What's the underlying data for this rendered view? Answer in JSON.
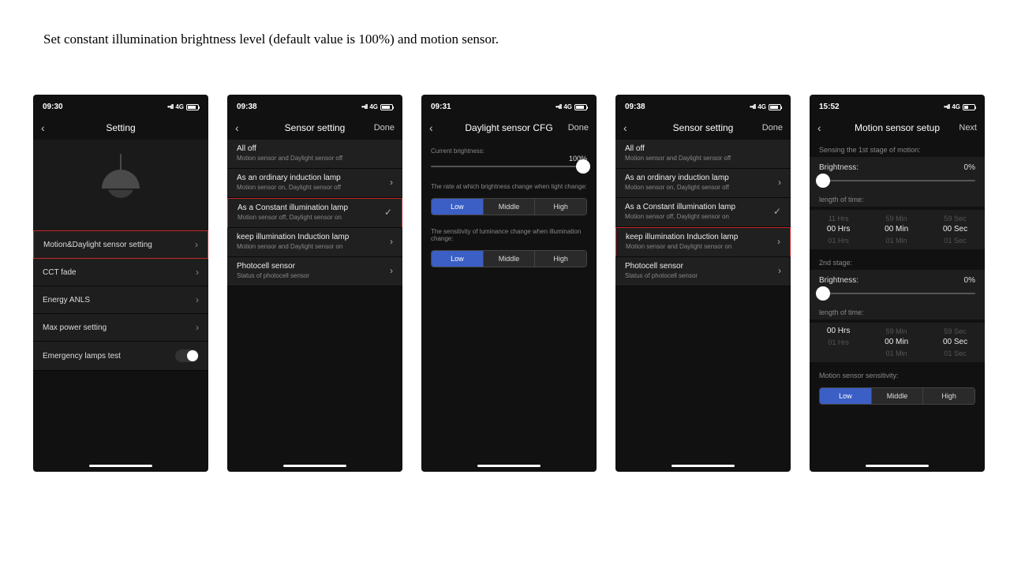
{
  "caption": "Set constant illumination brightness level (default value is 100%) and motion sensor.",
  "status": {
    "net": "4G"
  },
  "s1": {
    "time": "09:30",
    "title": "Setting",
    "rows": [
      "Motion&Daylight sensor setting",
      "CCT fade",
      "Energy ANLS",
      "Max power setting",
      "Emergency lamps test"
    ]
  },
  "s2": {
    "time": "09:38",
    "title": "Sensor setting",
    "done": "Done",
    "opts": [
      {
        "t": "All off",
        "s": "Motion sensor and Daylight sensor off"
      },
      {
        "t": "As an ordinary induction lamp",
        "s": "Motion sensor on,  Daylight sensor off"
      },
      {
        "t": "As a Constant illumination lamp",
        "s": "Motion sensor off,  Daylight sensor on"
      },
      {
        "t": "keep illumination Induction lamp",
        "s": "Motion sensor and Daylight sensor on"
      },
      {
        "t": "Photocell sensor",
        "s": "Status of photocell sensor"
      }
    ]
  },
  "s3": {
    "time": "09:31",
    "title": "Daylight sensor CFG",
    "done": "Done",
    "l1": "Current brightness:",
    "val": "100%",
    "l2": "The rate at which brightness change when light change:",
    "l3": "The sensitivity of luminance change when illumination change:",
    "seg": [
      "Low",
      "Middle",
      "High"
    ]
  },
  "s4": {
    "time": "09:38",
    "title": "Sensor setting",
    "done": "Done"
  },
  "s5": {
    "time": "15:52",
    "title": "Motion sensor setup",
    "next": "Next",
    "h1": "Sensing the 1st stage of motion:",
    "bright": "Brightness:",
    "bval": "0%",
    "len": "length of time:",
    "p1": [
      [
        "11 Hrs",
        "59 Min",
        "59 Sec"
      ],
      [
        "00 Hrs",
        "00 Min",
        "00 Sec"
      ],
      [
        "01 Hrs",
        "01 Min",
        "01 Sec"
      ]
    ],
    "h2": "2nd stage:",
    "p2": [
      [
        "",
        "59 Min",
        "59 Sec"
      ],
      [
        "00 Hrs",
        "00 Min",
        "00 Sec"
      ],
      [
        "01 Hrs",
        "01 Min",
        "01 Sec"
      ]
    ],
    "h3": "Motion sensor sensitivity:",
    "seg": [
      "Low",
      "Middle",
      "High"
    ]
  }
}
